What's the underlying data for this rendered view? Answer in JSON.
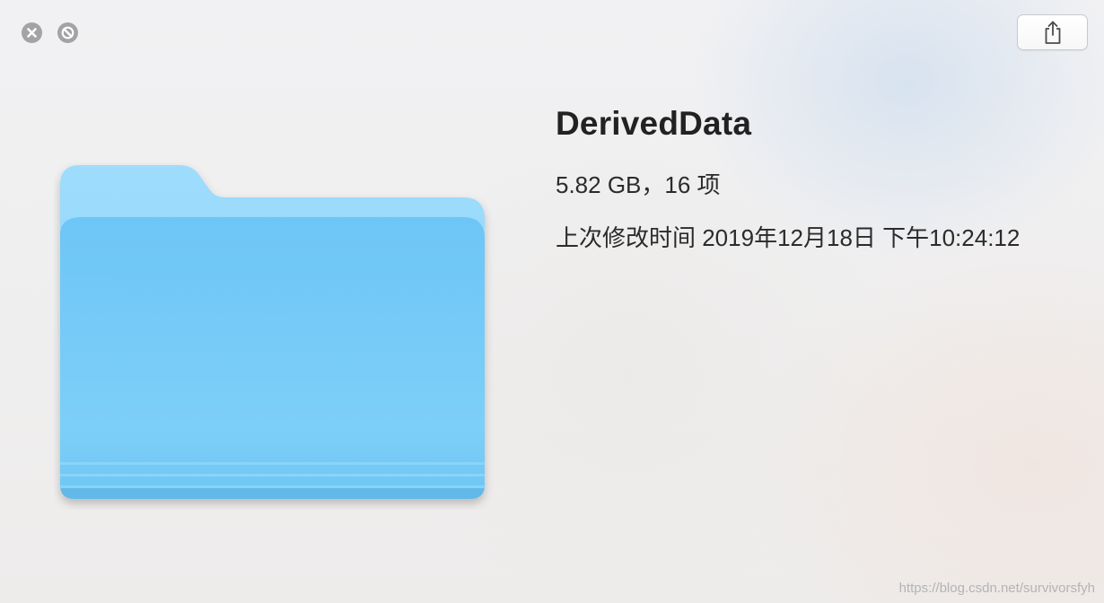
{
  "window": {
    "title_buttons": {
      "close_icon": "close-icon",
      "fullscreen_icon": "no-entry-icon"
    },
    "share_icon": "share-icon"
  },
  "file": {
    "name": "DerivedData",
    "size_summary": "5.82 GB，16 项",
    "modified": "上次修改时间 2019年12月18日 下午10:24:12",
    "icon": "folder-icon",
    "icon_color": "#6ec8f7"
  },
  "watermark": "https://blog.csdn.net/survivorsfyh",
  "colors": {
    "folder_tab": "#98d9fb",
    "folder_front": "#6ec8f7",
    "control_gray": "#a3a3a6"
  }
}
